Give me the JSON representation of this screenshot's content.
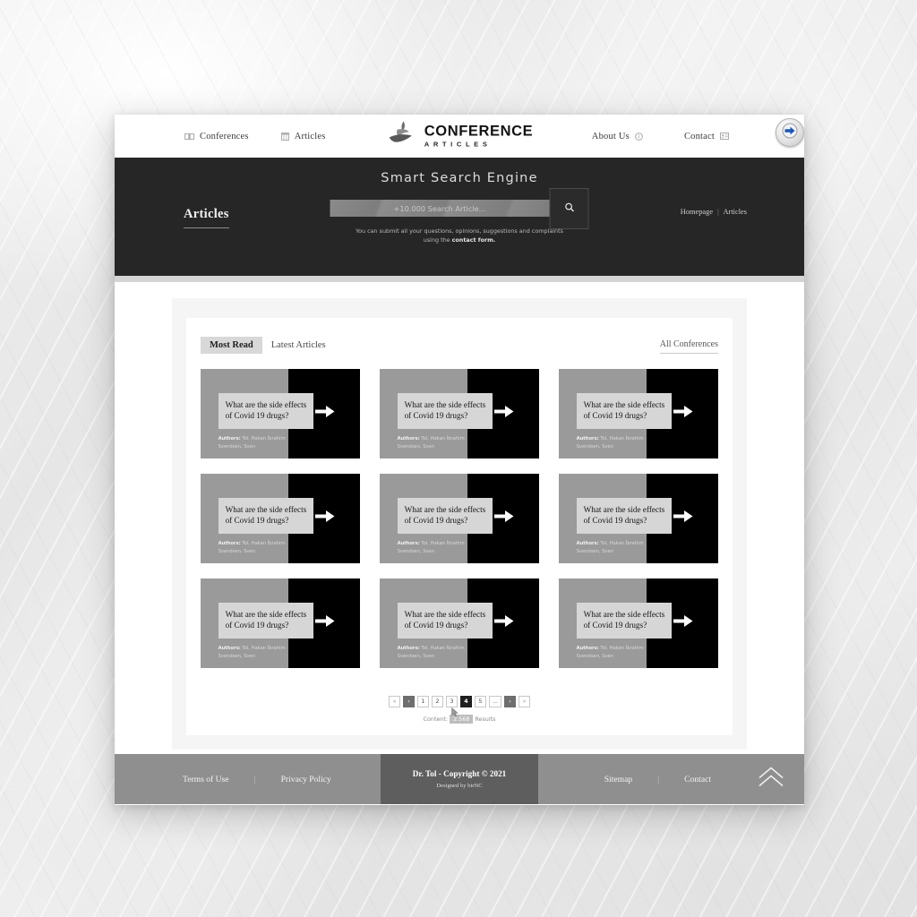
{
  "header": {
    "nav_left": [
      {
        "label": "Conferences",
        "icon": "book-icon"
      },
      {
        "label": "Articles",
        "icon": "grid-icon"
      }
    ],
    "nav_right": [
      {
        "label": "About Us",
        "icon": "info-icon"
      },
      {
        "label": "Contact",
        "icon": "card-icon"
      }
    ],
    "brand_main": "CONFERENCE",
    "brand_sub": "ARTICLES",
    "action_button_icon": "blue-arrow-right-icon"
  },
  "hero": {
    "title": "Smart Search Engine",
    "page_name": "Articles",
    "search_placeholder": "+10.000 Search Article...",
    "search_value": "",
    "search_icon": "search-icon",
    "note_prefix": "You can submit all your questions, opinions, suggestions and complaints using the ",
    "note_link": "contact form.",
    "breadcrumb_home": "Homepage",
    "breadcrumb_sep": "|",
    "breadcrumb_current": "Articles"
  },
  "content": {
    "tabs": [
      {
        "label": "Most Read",
        "active": true
      },
      {
        "label": "Latest Articles",
        "active": false
      }
    ],
    "all_conferences_label": "All Conferences",
    "card": {
      "title": "What are the side effects of Covid 19 drugs?",
      "authors_label": "Authors:",
      "authors_value": " Tol, Hakan İbrahim Svendsen, Sven",
      "arrow_icon": "arrow-right-icon"
    },
    "cards_count": 9
  },
  "pagination": {
    "items": [
      {
        "label": "«",
        "style": "ghost"
      },
      {
        "label": "‹",
        "style": "dark"
      },
      {
        "label": "1",
        "style": "plain"
      },
      {
        "label": "2",
        "style": "plain"
      },
      {
        "label": "3",
        "style": "plain"
      },
      {
        "label": "4",
        "style": "active"
      },
      {
        "label": "5",
        "style": "plain"
      },
      {
        "label": "...",
        "style": "plain"
      },
      {
        "label": "›",
        "style": "dark"
      },
      {
        "label": "»",
        "style": "ghost"
      }
    ],
    "results_prefix": "Content:",
    "results_count": "2.568",
    "results_suffix": "Results",
    "cursor_icon": "cursor-icon"
  },
  "footer": {
    "left_links": [
      "Terms of Use",
      "Privacy Policy"
    ],
    "right_links": [
      "Sitemap",
      "Contact"
    ],
    "divider": "|",
    "copyright": "Dr. Tol - Copyright © 2021",
    "designed_by": "Designed by birNC",
    "to_top_icon": "chevron-up-icon"
  },
  "colors": {
    "hero_bg": "#262626",
    "footer_bg": "#8f8f8f",
    "footer_center_bg": "#5e5e5e",
    "card_black": "#000000",
    "card_gray": "#9a9a9a",
    "accent_blue": "#1559c0"
  }
}
